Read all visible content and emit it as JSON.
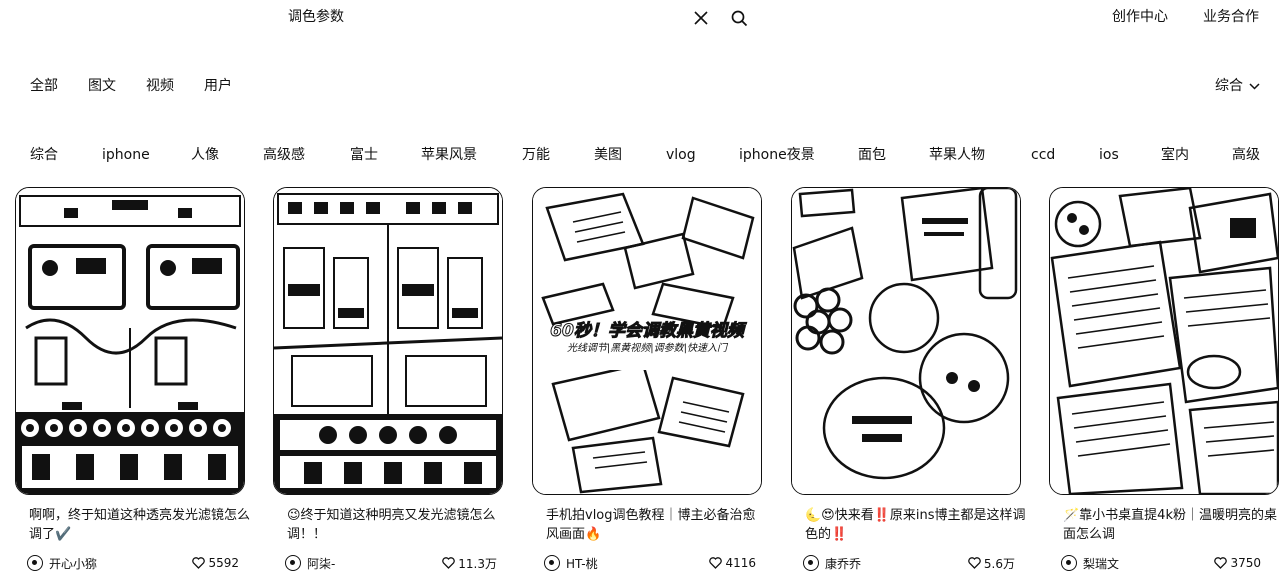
{
  "search": {
    "query": "调色参数"
  },
  "header": {
    "creator_center": "创作中心",
    "business": "业务合作"
  },
  "type_tabs": [
    "全部",
    "图文",
    "视频",
    "用户"
  ],
  "sort": {
    "label": "综合"
  },
  "keywords": [
    "综合",
    "iphone",
    "人像",
    "高级感",
    "富士",
    "苹果风景",
    "万能",
    "美图",
    "vlog",
    "iphone夜景",
    "面包",
    "苹果人物",
    "ccd",
    "ios",
    "室内",
    "高级"
  ],
  "cards": [
    {
      "title": "啊啊，终于知道这种透亮发光滤镜怎么调了✔️",
      "author": "开心小猕",
      "likes": "5592",
      "overlay": "",
      "overlay_sub": ""
    },
    {
      "title": "😉终于知道这种明亮又发光滤镜怎么调！！",
      "author": "阿柒-",
      "likes": "11.3万",
      "overlay": "",
      "overlay_sub": ""
    },
    {
      "title": "手机拍vlog调色教程｜博主必备治愈风画面🔥",
      "author": "HT-桃",
      "likes": "4116",
      "overlay": "60秒！学会调教黑黄视频",
      "overlay_sub": "光线调节|黑黄视频|调参数|快速入门"
    },
    {
      "title": "🌜😍快来看‼️原来ins博主都是这样调色的‼️",
      "author": "康乔乔",
      "likes": "5.6万",
      "overlay": "",
      "overlay_sub": ""
    },
    {
      "title": "🪄靠小书桌直提4k粉｜温暖明亮的桌面怎么调",
      "author": "梨瑞文",
      "likes": "3750",
      "overlay": "",
      "overlay_sub": ""
    }
  ]
}
